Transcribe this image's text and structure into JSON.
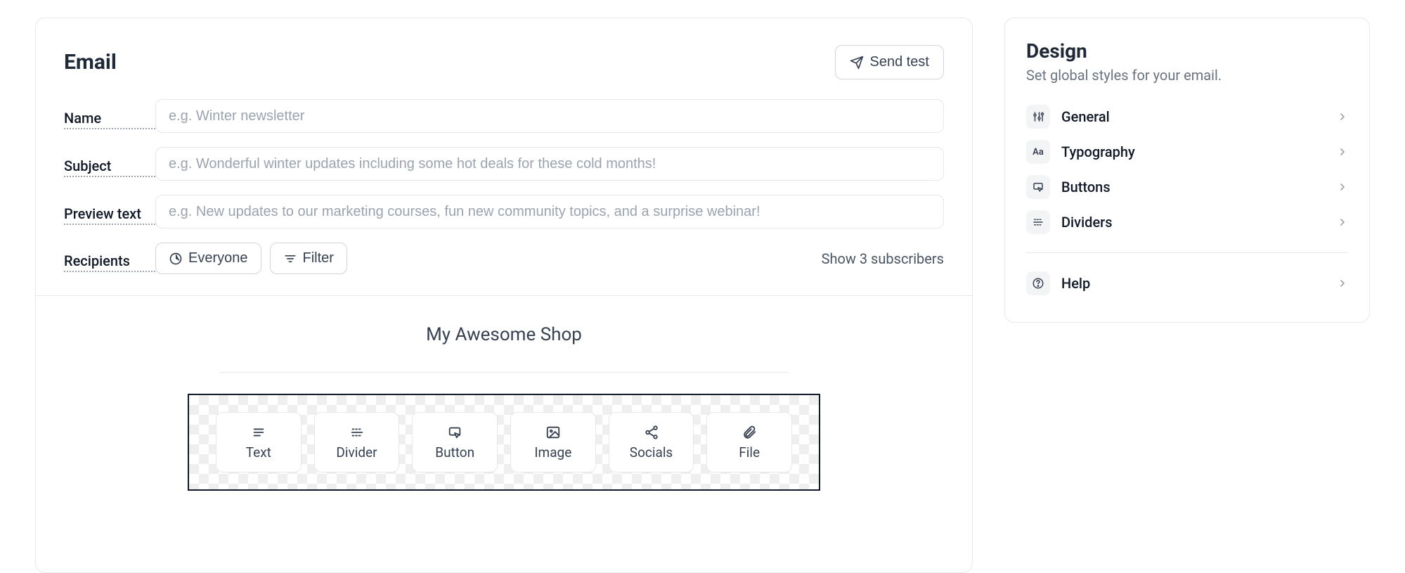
{
  "header": {
    "title": "Email",
    "send_test_label": "Send test"
  },
  "form": {
    "name": {
      "label": "Name",
      "placeholder": "e.g. Winter newsletter",
      "value": ""
    },
    "subject": {
      "label": "Subject",
      "placeholder": "e.g. Wonderful winter updates including some hot deals for these cold months!",
      "value": ""
    },
    "preview": {
      "label": "Preview text",
      "placeholder": "e.g. New updates to our marketing courses, fun new community topics, and a surprise webinar!",
      "value": ""
    },
    "recipients": {
      "label": "Recipients",
      "everyone_label": "Everyone",
      "filter_label": "Filter",
      "show_subs_label": "Show 3 subscribers"
    }
  },
  "editor": {
    "shop_title": "My Awesome Shop",
    "blocks": {
      "text": "Text",
      "divider": "Divider",
      "button": "Button",
      "image": "Image",
      "socials": "Socials",
      "file": "File"
    }
  },
  "design": {
    "title": "Design",
    "subtitle": "Set global styles for your email.",
    "items": {
      "general": "General",
      "typography": "Typography",
      "buttons": "Buttons",
      "dividers": "Dividers",
      "help": "Help"
    },
    "typography_icon_text": "Aa"
  }
}
